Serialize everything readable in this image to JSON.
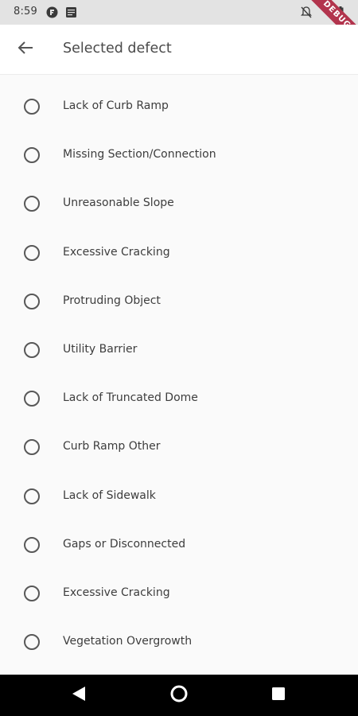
{
  "status_bar": {
    "time": "8:59",
    "debug_label": "DEBUG"
  },
  "app_bar": {
    "title": "Selected defect",
    "back_icon": "arrow-left-icon"
  },
  "options": [
    {
      "label": "Lack of Curb Ramp",
      "selected": false
    },
    {
      "label": "Missing Section/Connection",
      "selected": false
    },
    {
      "label": "Unreasonable Slope",
      "selected": false
    },
    {
      "label": "Excessive Cracking",
      "selected": false
    },
    {
      "label": "Protruding Object",
      "selected": false
    },
    {
      "label": "Utility Barrier",
      "selected": false
    },
    {
      "label": "Lack of Truncated Dome",
      "selected": false
    },
    {
      "label": "Curb Ramp Other",
      "selected": false
    },
    {
      "label": "Lack of Sidewalk",
      "selected": false
    },
    {
      "label": "Gaps or Disconnected",
      "selected": false
    },
    {
      "label": "Excessive Cracking",
      "selected": false
    },
    {
      "label": "Vegetation Overgrowth",
      "selected": false
    }
  ],
  "nav_bar": {
    "back_icon": "triangle-back-icon",
    "home_icon": "circle-home-icon",
    "recents_icon": "square-recents-icon"
  },
  "colors": {
    "status_bar_bg": "#e3e3e3",
    "app_bar_bg": "#ffffff",
    "page_bg": "#fafafa",
    "debug_ribbon": "#b2344d",
    "nav_bar_bg": "#000000"
  }
}
